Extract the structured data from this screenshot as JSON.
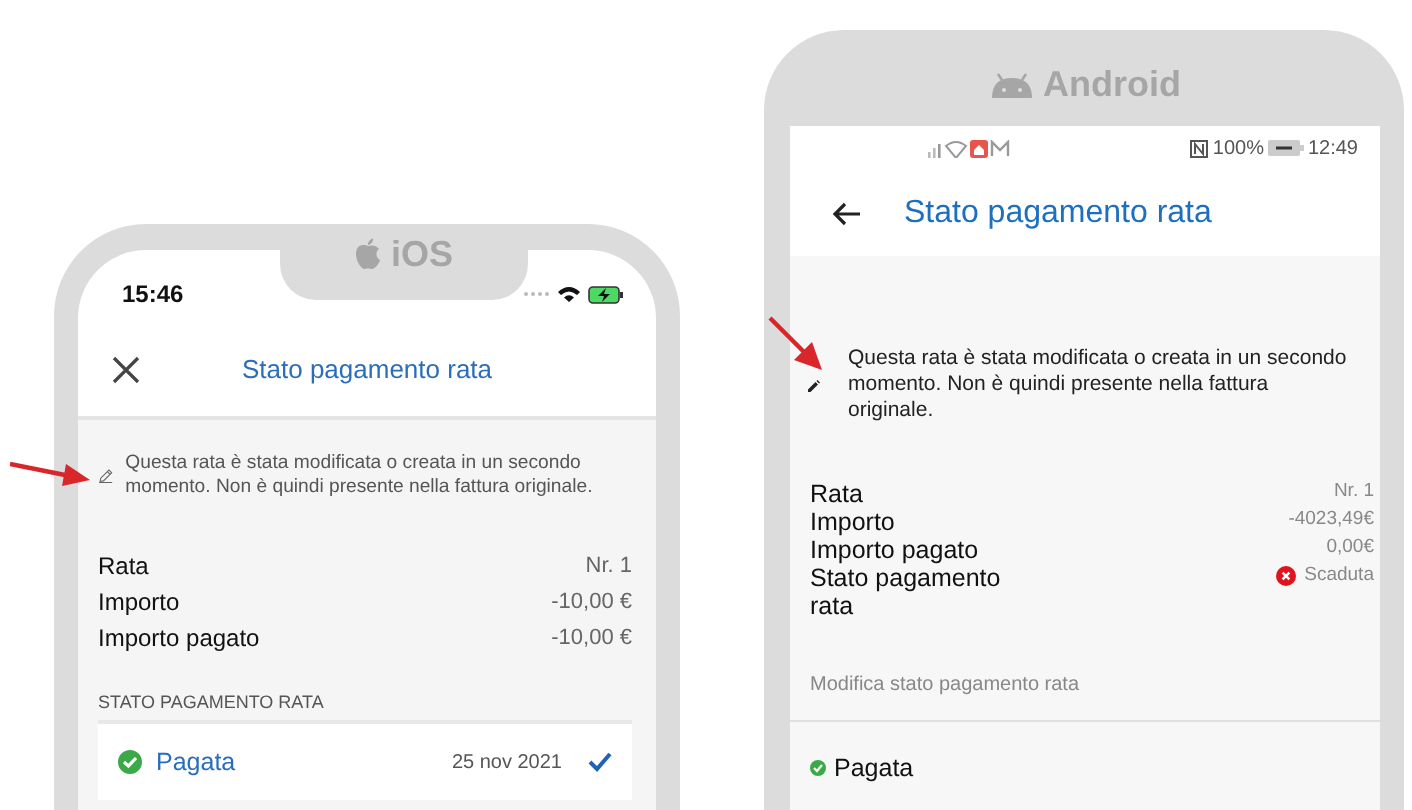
{
  "ios": {
    "platform_label": "iOS",
    "status_time": "15:46",
    "title": "Stato pagamento rata",
    "note": "Questa rata è stata modificata o creata in un secondo momento. Non è quindi presente nella fattura originale.",
    "rows": [
      {
        "label": "Rata",
        "value": "Nr. 1"
      },
      {
        "label": "Importo",
        "value": "-10,00 €"
      },
      {
        "label": "Importo pagato",
        "value": "-10,00 €"
      }
    ],
    "section_header": "STATO PAGAMENTO RATA",
    "status_options": [
      {
        "label": "Pagata",
        "date": "25 nov 2021",
        "selected": true
      }
    ]
  },
  "android": {
    "platform_label": "Android",
    "status_battery": "100%",
    "status_time": "12:49",
    "title": "Stato pagamento rata",
    "note": "Questa rata è stata modificata o creata in un secondo momento. Non è quindi presente nella fattura originale.",
    "rows": [
      {
        "label": "Rata",
        "value": "Nr. 1",
        "kind": "text"
      },
      {
        "label": "Importo",
        "value": "-4023,49€",
        "kind": "text"
      },
      {
        "label": "Importo pagato",
        "value": "0,00€",
        "kind": "text"
      },
      {
        "label": "Stato pagamento rata",
        "value": "Scaduta",
        "kind": "status"
      }
    ],
    "section_header": "Modifica stato pagamento rata",
    "status_options": [
      {
        "label": "Pagata"
      }
    ]
  }
}
